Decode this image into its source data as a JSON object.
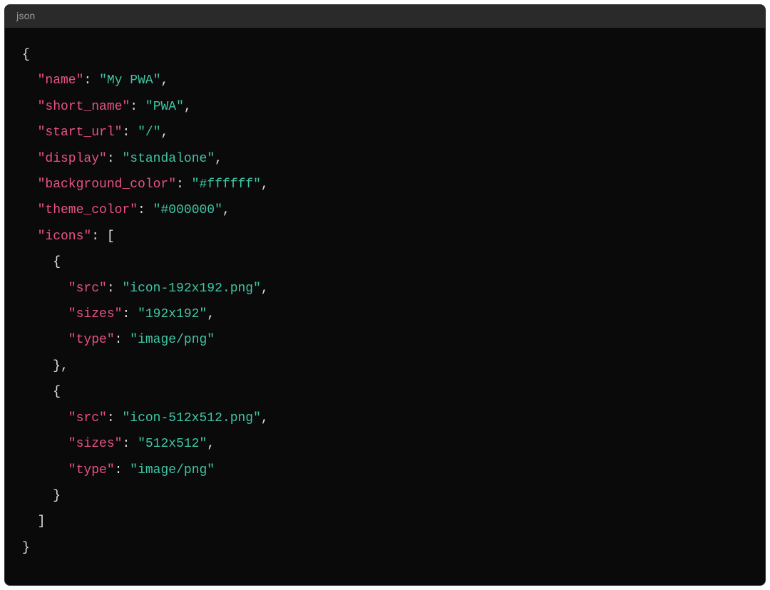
{
  "header": {
    "language_label": "json"
  },
  "json_content": {
    "keys": {
      "name": "name",
      "short_name": "short_name",
      "start_url": "start_url",
      "display": "display",
      "background_color": "background_color",
      "theme_color": "theme_color",
      "icons": "icons",
      "src": "src",
      "sizes": "sizes",
      "type": "type"
    },
    "values": {
      "name": "My PWA",
      "short_name": "PWA",
      "start_url": "/",
      "display": "standalone",
      "background_color": "#ffffff",
      "theme_color": "#000000",
      "icons": [
        {
          "src": "icon-192x192.png",
          "sizes": "192x192",
          "type": "image/png"
        },
        {
          "src": "icon-512x512.png",
          "sizes": "512x512",
          "type": "image/png"
        }
      ]
    }
  },
  "tokens": {
    "brace_open": "{",
    "brace_close": "}",
    "bracket_open": "[",
    "bracket_close": "]",
    "quote": "\"",
    "colon": ":",
    "comma": ",",
    "space": " "
  }
}
